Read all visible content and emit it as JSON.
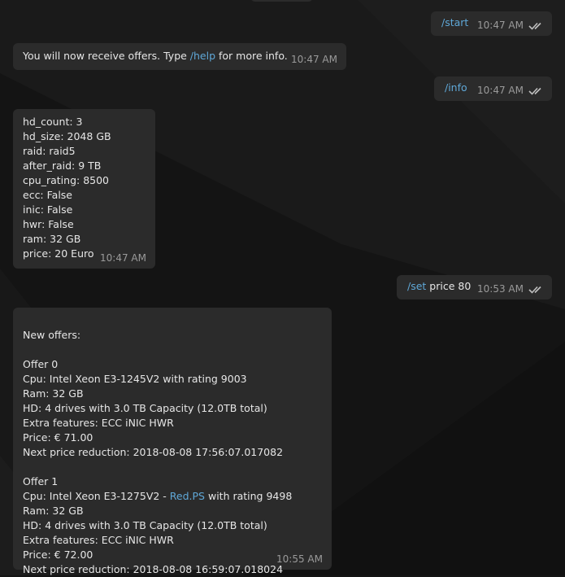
{
  "messages": {
    "m1": {
      "cmd": "/start",
      "time": "10:47 AM"
    },
    "m2": {
      "pre": "You will now receive offers. Type ",
      "cmd": "/help",
      "post": " for more info.",
      "time": "10:47 AM"
    },
    "m3": {
      "cmd": "/info",
      "time": "10:47 AM"
    },
    "m4": {
      "text": "hd_count: 3\nhd_size: 2048 GB\nraid: raid5\nafter_raid: 9 TB\ncpu_rating: 8500\necc: False\ninic: False\nhwr: False\nram: 32 GB\nprice: 20 Euro",
      "time": "10:47 AM"
    },
    "m5": {
      "cmd": "/set",
      "rest": " price 80",
      "time": "10:53 AM"
    },
    "m6": {
      "part1": "New offers:\n\nOffer 0\nCpu: Intel Xeon E3-1245V2 with rating 9003\nRam: 32 GB\nHD: 4 drives with 3.0 TB Capacity (12.0TB total)\nExtra features: ECC iNIC HWR\nPrice: € 71.00\nNext price reduction: 2018-08-08 17:56:07.017082\n\nOffer 1\nCpu: Intel Xeon E3-1275V2 - ",
      "link": "Red.PS",
      "part2": " with rating 9498\nRam: 32 GB\nHD: 4 drives with 3.0 TB Capacity (12.0TB total)\nExtra features: ECC iNIC HWR\nPrice: € 72.00\nNext price reduction: 2018-08-08 16:59:07.018024",
      "time": "10:55 AM"
    }
  },
  "colors": {
    "bubble": "#2b2b2b",
    "command": "#5fa8d8",
    "background": "#141414"
  },
  "icons": {
    "read_receipt": "double-check-icon"
  }
}
